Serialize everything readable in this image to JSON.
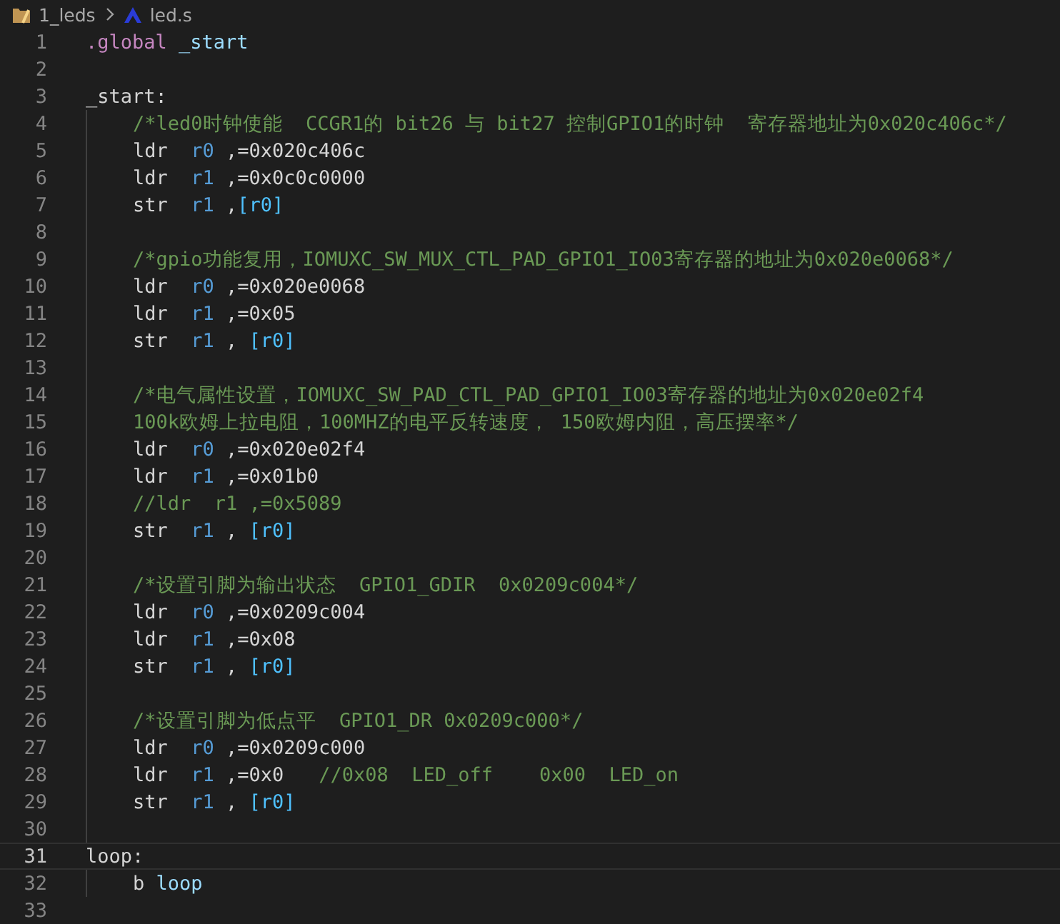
{
  "breadcrumb": [
    {
      "kind": "folder",
      "text": "1_leds"
    },
    {
      "kind": "file",
      "text": "led.s"
    }
  ],
  "lines": [
    {
      "number": "1",
      "current": false,
      "tokens": [
        {
          "kind": "directive",
          "text": ".global "
        },
        {
          "kind": "symbol",
          "text": "_start"
        }
      ]
    },
    {
      "number": "2",
      "current": false
    },
    {
      "number": "3",
      "current": false,
      "tokens": [
        {
          "kind": "plain",
          "text": "_start:"
        }
      ],
      "children": [
        {
          "number": "4",
          "current": false,
          "tokens": [
            {
              "kind": "comment",
              "text": "/*led0时钟使能  CCGR1的 bit26 与 bit27 控制GPIO1的时钟  寄存器地址为0x020c406c*/"
            }
          ]
        },
        {
          "number": "5",
          "current": false,
          "tokens": [
            {
              "kind": "plain",
              "text": "ldr  "
            },
            {
              "kind": "reg",
              "text": "r0"
            },
            {
              "kind": "plain",
              "text": " ,=0x020c406c"
            }
          ]
        },
        {
          "number": "6",
          "current": false,
          "tokens": [
            {
              "kind": "plain",
              "text": "ldr  "
            },
            {
              "kind": "reg",
              "text": "r1"
            },
            {
              "kind": "plain",
              "text": " ,=0x0c0c0000"
            }
          ]
        },
        {
          "number": "7",
          "current": false,
          "tokens": [
            {
              "kind": "plain",
              "text": "str  "
            },
            {
              "kind": "reg",
              "text": "r1"
            },
            {
              "kind": "plain",
              "text": " ,"
            },
            {
              "kind": "bracket",
              "text": "[r0]"
            }
          ]
        },
        {
          "number": "8",
          "current": false
        },
        {
          "number": "9",
          "current": false,
          "tokens": [
            {
              "kind": "comment",
              "text": "/*gpio功能复用，IOMUXC_SW_MUX_CTL_PAD_GPIO1_IO03寄存器的地址为0x020e0068*/"
            }
          ]
        },
        {
          "number": "10",
          "current": false,
          "tokens": [
            {
              "kind": "plain",
              "text": "ldr  "
            },
            {
              "kind": "reg",
              "text": "r0"
            },
            {
              "kind": "plain",
              "text": " ,=0x020e0068"
            }
          ]
        },
        {
          "number": "11",
          "current": false,
          "tokens": [
            {
              "kind": "plain",
              "text": "ldr  "
            },
            {
              "kind": "reg",
              "text": "r1"
            },
            {
              "kind": "plain",
              "text": " ,=0x05"
            }
          ]
        },
        {
          "number": "12",
          "current": false,
          "tokens": [
            {
              "kind": "plain",
              "text": "str  "
            },
            {
              "kind": "reg",
              "text": "r1"
            },
            {
              "kind": "plain",
              "text": " , "
            },
            {
              "kind": "bracket",
              "text": "[r0]"
            }
          ]
        },
        {
          "number": "13",
          "current": false
        },
        {
          "number": "14",
          "current": false,
          "tokens": [
            {
              "kind": "comment",
              "text": "/*电气属性设置，IOMUXC_SW_PAD_CTL_PAD_GPIO1_IO03寄存器的地址为0x020e02f4"
            }
          ]
        },
        {
          "number": "15",
          "current": false,
          "tokens": [
            {
              "kind": "comment",
              "text": "100k欧姆上拉电阻，100MHZ的电平反转速度， 150欧姆内阻，高压摆率*/"
            }
          ]
        },
        {
          "number": "16",
          "current": false,
          "tokens": [
            {
              "kind": "plain",
              "text": "ldr  "
            },
            {
              "kind": "reg",
              "text": "r0"
            },
            {
              "kind": "plain",
              "text": " ,=0x020e02f4"
            }
          ]
        },
        {
          "number": "17",
          "current": false,
          "tokens": [
            {
              "kind": "plain",
              "text": "ldr  "
            },
            {
              "kind": "reg",
              "text": "r1"
            },
            {
              "kind": "plain",
              "text": " ,=0x01b0"
            }
          ]
        },
        {
          "number": "18",
          "current": false,
          "tokens": [
            {
              "kind": "comment",
              "text": "//ldr  r1 ,=0x5089"
            }
          ]
        },
        {
          "number": "19",
          "current": false,
          "tokens": [
            {
              "kind": "plain",
              "text": "str  "
            },
            {
              "kind": "reg",
              "text": "r1"
            },
            {
              "kind": "plain",
              "text": " , "
            },
            {
              "kind": "bracket",
              "text": "[r0]"
            }
          ]
        },
        {
          "number": "20",
          "current": false
        },
        {
          "number": "21",
          "current": false,
          "tokens": [
            {
              "kind": "comment",
              "text": "/*设置引脚为输出状态  GPIO1_GDIR  0x0209c004*/"
            }
          ]
        },
        {
          "number": "22",
          "current": false,
          "tokens": [
            {
              "kind": "plain",
              "text": "ldr  "
            },
            {
              "kind": "reg",
              "text": "r0"
            },
            {
              "kind": "plain",
              "text": " ,=0x0209c004"
            }
          ]
        },
        {
          "number": "23",
          "current": false,
          "tokens": [
            {
              "kind": "plain",
              "text": "ldr  "
            },
            {
              "kind": "reg",
              "text": "r1"
            },
            {
              "kind": "plain",
              "text": " ,=0x08"
            }
          ]
        },
        {
          "number": "24",
          "current": false,
          "tokens": [
            {
              "kind": "plain",
              "text": "str  "
            },
            {
              "kind": "reg",
              "text": "r1"
            },
            {
              "kind": "plain",
              "text": " , "
            },
            {
              "kind": "bracket",
              "text": "[r0]"
            }
          ]
        },
        {
          "number": "25",
          "current": false
        },
        {
          "number": "26",
          "current": false,
          "tokens": [
            {
              "kind": "comment",
              "text": "/*设置引脚为低点平  GPIO1_DR 0x0209c000*/"
            }
          ]
        },
        {
          "number": "27",
          "current": false,
          "tokens": [
            {
              "kind": "plain",
              "text": "ldr  "
            },
            {
              "kind": "reg",
              "text": "r0"
            },
            {
              "kind": "plain",
              "text": " ,=0x0209c000"
            }
          ]
        },
        {
          "number": "28",
          "current": false,
          "tokens": [
            {
              "kind": "plain",
              "text": "ldr  "
            },
            {
              "kind": "reg",
              "text": "r1"
            },
            {
              "kind": "plain",
              "text": " ,=0x0   "
            },
            {
              "kind": "comment",
              "text": "//0x08  LED_off    0x00  LED_on"
            }
          ]
        },
        {
          "number": "29",
          "current": false,
          "tokens": [
            {
              "kind": "plain",
              "text": "str  "
            },
            {
              "kind": "reg",
              "text": "r1"
            },
            {
              "kind": "plain",
              "text": " , "
            },
            {
              "kind": "bracket",
              "text": "[r0]"
            }
          ]
        },
        {
          "number": "30",
          "current": false
        }
      ]
    },
    {
      "number": "31",
      "current": true,
      "tokens": [
        {
          "kind": "plain",
          "text": "loop:"
        }
      ],
      "children": [
        {
          "number": "32",
          "current": false,
          "tokens": [
            {
              "kind": "plain",
              "text": "b "
            },
            {
              "kind": "symbol",
              "text": "loop"
            }
          ]
        }
      ]
    },
    {
      "number": "33",
      "current": false
    }
  ]
}
